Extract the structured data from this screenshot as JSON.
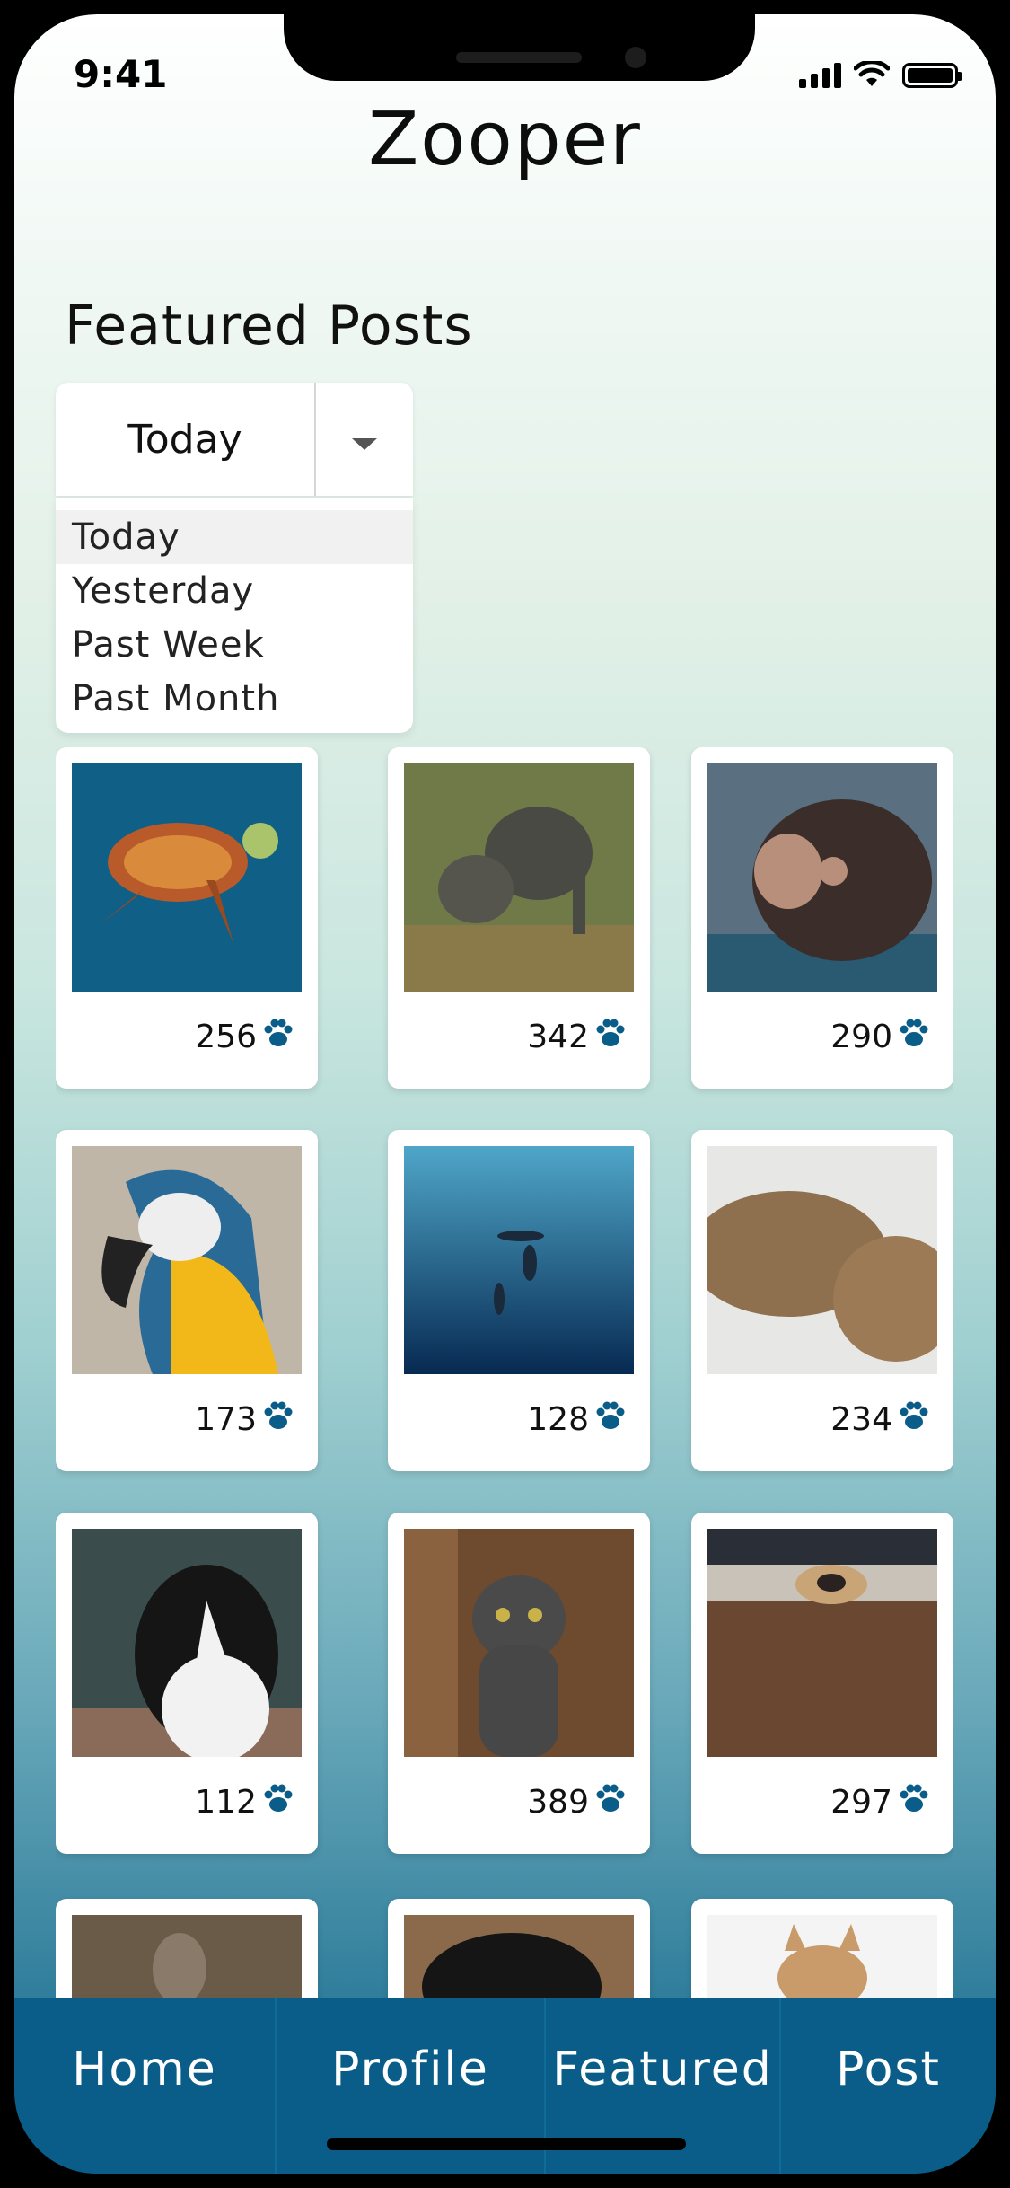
{
  "status": {
    "time": "9:41"
  },
  "header": {
    "title": "Zooper"
  },
  "section": {
    "title": "Featured Posts"
  },
  "filter": {
    "selected": "Today",
    "options": [
      "Today",
      "Yesterday",
      "Past Week",
      "Past Month"
    ]
  },
  "posts": [
    {
      "subject": "sea turtle",
      "likes": "256"
    },
    {
      "subject": "elephants",
      "likes": "342"
    },
    {
      "subject": "baby monkey",
      "likes": "290"
    },
    {
      "subject": "macaw parrot",
      "likes": "173"
    },
    {
      "subject": "dolphins underwater",
      "likes": "128"
    },
    {
      "subject": "sea lions",
      "likes": "234"
    },
    {
      "subject": "border collie",
      "likes": "112"
    },
    {
      "subject": "gray cat",
      "likes": "389"
    },
    {
      "subject": "pug",
      "likes": "297"
    },
    {
      "subject": "rabbit",
      "likes": ""
    },
    {
      "subject": "black dog",
      "likes": ""
    },
    {
      "subject": "shiba puppy",
      "likes": ""
    }
  ],
  "nav": {
    "items": [
      "Home",
      "Profile",
      "Featured",
      "Post"
    ]
  },
  "colors": {
    "nav_bg": "#0a5d88",
    "paw": "#0a5d88"
  }
}
